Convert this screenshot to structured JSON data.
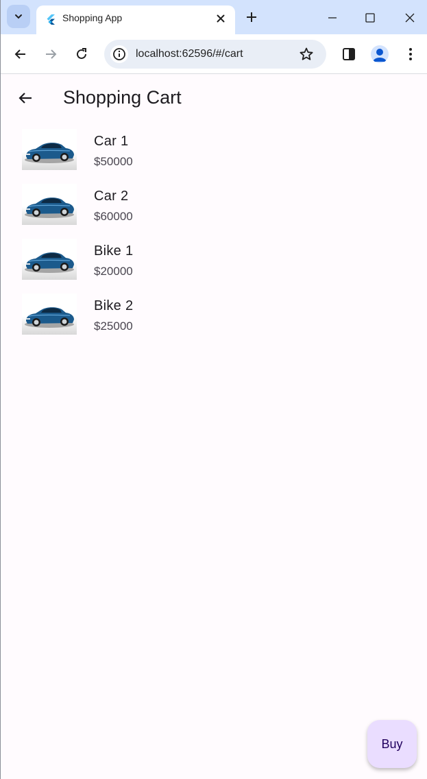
{
  "browser": {
    "tab_title": "Shopping App",
    "url": "localhost:62596/#/cart"
  },
  "app": {
    "title": "Shopping Cart",
    "items": [
      {
        "name": "Car 1",
        "price": "$50000",
        "image": "blue-car-image"
      },
      {
        "name": "Car 2",
        "price": "$60000",
        "image": "blue-car-image"
      },
      {
        "name": "Bike 1",
        "price": "$20000",
        "image": "blue-car-image"
      },
      {
        "name": "Bike 2",
        "price": "$25000",
        "image": "blue-car-image"
      }
    ],
    "buy_label": "Buy"
  },
  "colors": {
    "tabstrip": "#d3e3fd",
    "background": "#fffbfe",
    "fab": "#eaddff",
    "car_body": "#1b5a8c"
  }
}
